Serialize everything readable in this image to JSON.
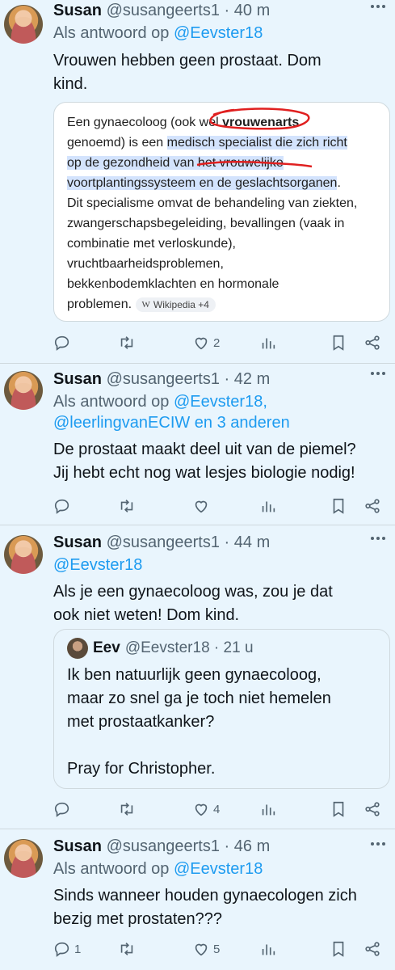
{
  "tweets": [
    {
      "name": "Susan",
      "handle": "@susangeerts1",
      "time": "40 m",
      "reply_prefix": "Als antwoord op ",
      "reply_to": "@Eevster18",
      "text_line1": "Vrouwen hebben geen prostaat. Dom",
      "text_line2": "kind.",
      "actions": {
        "replies": "",
        "retweets": "",
        "likes": "2"
      }
    },
    {
      "name": "Susan",
      "handle": "@susangeerts1",
      "time": "42 m",
      "reply_prefix": "Als antwoord op ",
      "reply_to_line1": "@Eevster18,",
      "reply_to_line2": "@leerlingvanECIW en 3 anderen",
      "text_line1": "De prostaat maakt deel uit van de piemel?",
      "text_line2": "Jij hebt echt nog wat lesjes biologie nodig!",
      "actions": {
        "replies": "",
        "retweets": "",
        "likes": ""
      }
    },
    {
      "name": "Susan",
      "handle": "@susangeerts1",
      "time": "44 m",
      "reply_to": "@Eevster18",
      "text_line1": "Als je een gynaecoloog was, zou je dat",
      "text_line2": "ook niet weten! Dom kind.",
      "actions": {
        "replies": "",
        "retweets": "",
        "likes": "4"
      }
    },
    {
      "name": "Susan",
      "handle": "@susangeerts1",
      "time": "46 m",
      "reply_prefix": "Als antwoord op ",
      "reply_to": "@Eevster18",
      "text_line1": "Sinds wanneer houden gynaecologen zich",
      "text_line2": "bezig met prostaten???",
      "actions": {
        "replies": "1",
        "retweets": "",
        "likes": "5"
      }
    }
  ],
  "screenshot_card": {
    "l1a": "Een gynaecoloog (ook wel ",
    "l1b": "vrouwenarts",
    "l2a": "genoemd) is een ",
    "l2b": "medisch specialist die zich richt",
    "l3": "op de gezondheid van het vrouwelijke",
    "l4a": "voortplantingssysteem en de geslachtsorganen",
    "l4b": ".",
    "l5": "Dit specialisme omvat de behandeling van ziekten,",
    "l6": "zwangerschapsbegeleiding, bevallingen (vaak in",
    "l7": "combinatie met verloskunde),",
    "l8": "vruchtbaarheidsproblemen,",
    "l9": "bekkenbodemklachten en hormonale",
    "l10": "problemen.",
    "chip_icon": "W",
    "chip_label": "Wikipedia +4"
  },
  "quoted_tweet": {
    "name": "Eev",
    "handle": "@Eevster18",
    "time": "21 u",
    "line1": "Ik ben natuurlijk geen gynaecoloog,",
    "line2": "maar zo snel ga je toch niet hemelen",
    "line3": "met prostaatkanker?",
    "line4": "Pray for Christopher."
  },
  "separator": " · ",
  "icons": [
    "more-icon",
    "reply-icon",
    "retweet-icon",
    "like-icon",
    "views-icon",
    "bookmark-icon",
    "share-icon"
  ],
  "colors": {
    "background": "#e9f5fd",
    "accent": "#1d9bf0",
    "muted": "#536471",
    "annotation_red": "#e02020"
  }
}
